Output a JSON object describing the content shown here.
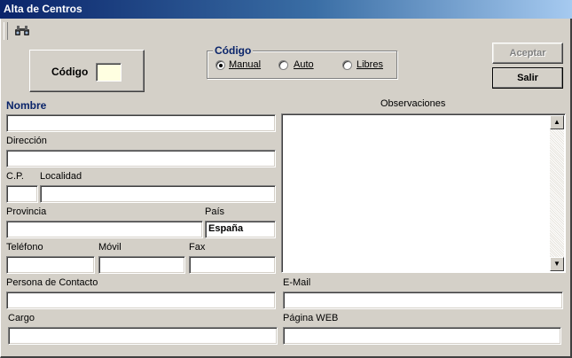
{
  "window": {
    "title": "Alta de Centros"
  },
  "toolbar": {
    "search_icon": "binoculars-icon"
  },
  "code_panel": {
    "label": "Código",
    "value": ""
  },
  "code_group": {
    "title": "Código",
    "options": [
      {
        "label": "Manual",
        "checked": true
      },
      {
        "label": "Auto",
        "checked": false
      },
      {
        "label": "Libres",
        "checked": false
      }
    ]
  },
  "buttons": {
    "accept": "Aceptar",
    "exit": "Salir"
  },
  "form": {
    "nombre_label": "Nombre",
    "direccion_label": "Dirección",
    "cp_label": "C.P.",
    "localidad_label": "Localidad",
    "provincia_label": "Provincia",
    "pais_label": "País",
    "pais_value": "España",
    "telefono_label": "Teléfono",
    "movil_label": "Móvil",
    "fax_label": "Fax",
    "contacto_label": "Persona de Contacto",
    "cargo_label": "Cargo",
    "observaciones_label": "Observaciones",
    "email_label": "E-Mail",
    "web_label": "Página WEB"
  }
}
